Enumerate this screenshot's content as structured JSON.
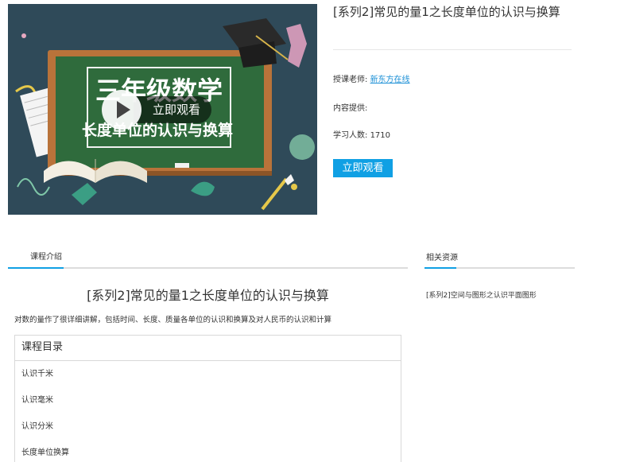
{
  "hero": {
    "board_line1": "三年级数学",
    "board_line2": "长度单位的认识与换算",
    "play_label": "立即观看"
  },
  "course": {
    "title": "[系列2]常见的量1之长度单位的认识与换算",
    "teacher_label": "授课老师:",
    "teacher_name": "新东方在线",
    "provider_label": "内容提供:",
    "students_label": "学习人数:",
    "students_count": "1710",
    "watch_button": "立即观看"
  },
  "tabs": {
    "intro": "课程介绍",
    "related": "相关资源"
  },
  "intro": {
    "heading": "[系列2]常见的量1之长度单位的认识与换算",
    "description": "对数的量作了很详细讲解，包括时间、长度、质量各单位的认识和换算及对人民币的认识和计算"
  },
  "catalog": {
    "header": "课程目录",
    "items": [
      "认识千米",
      "认识毫米",
      "认识分米",
      "长度单位换算"
    ]
  },
  "related": {
    "items": [
      "[系列2]空间与图形之认识平面图形"
    ]
  },
  "colors": {
    "accent": "#10a0e4",
    "link": "#1a8fd6",
    "chalkboard": "#2f6b3c",
    "board_frame": "#b9733a",
    "background_slate": "#2f4a59"
  },
  "icons": {
    "play": "play-icon",
    "graduation_cap": "graduation-cap-icon",
    "open_book": "open-book-icon",
    "paintbrush": "paintbrush-icon"
  }
}
